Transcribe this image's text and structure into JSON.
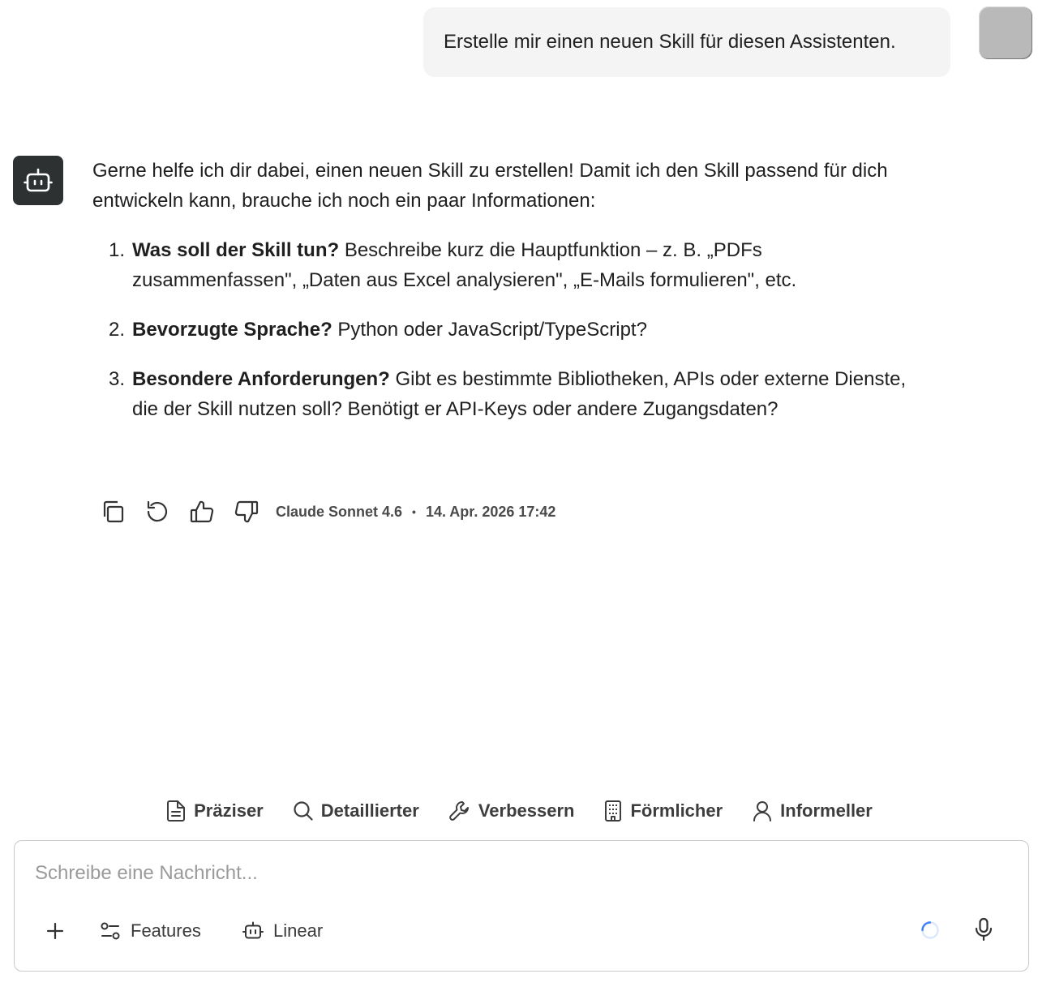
{
  "user_message": {
    "text": "Erstelle mir einen neuen Skill für diesen Assistenten."
  },
  "assistant_message": {
    "intro": "Gerne helfe ich dir dabei, einen neuen Skill zu erstellen! Damit ich den Skill passend für dich entwickeln kann, brauche ich noch ein paar Informationen:",
    "items": [
      {
        "num": "1.",
        "bold": "Was soll der Skill tun?",
        "text": " Beschreibe kurz die Hauptfunktion – z. B. „PDFs zusammenfassen\", „Daten aus Excel analysieren\", „E-Mails formulieren\", etc."
      },
      {
        "num": "2.",
        "bold": "Bevorzugte Sprache?",
        "text": " Python oder JavaScript/TypeScript?"
      },
      {
        "num": "3.",
        "bold": "Besondere Anforderungen?",
        "text": " Gibt es bestimmte Bibliotheken, APIs oder externe Dienste, die der Skill nutzen soll? Benötigt er API-Keys oder andere Zugangsdaten?"
      }
    ],
    "model": "Claude Sonnet 4.6",
    "separator": "•",
    "timestamp": "14. Apr. 2026 17:42",
    "action_icons": [
      "copy-icon",
      "regenerate-icon",
      "thumbs-up-icon",
      "thumbs-down-icon"
    ]
  },
  "quick_actions": [
    {
      "icon": "document-icon",
      "label": "Präziser"
    },
    {
      "icon": "search-icon",
      "label": "Detaillierter"
    },
    {
      "icon": "wrench-icon",
      "label": "Verbessern"
    },
    {
      "icon": "building-icon",
      "label": "Förmlicher"
    },
    {
      "icon": "user-icon",
      "label": "Informeller"
    }
  ],
  "composer": {
    "placeholder": "Schreibe eine Nachricht...",
    "features_label": "Features",
    "linear_label": "Linear"
  },
  "colors": {
    "user_bubble_bg": "#f4f4f4",
    "bot_avatar_bg": "#2e3132",
    "spinner": "#3b82f6"
  }
}
